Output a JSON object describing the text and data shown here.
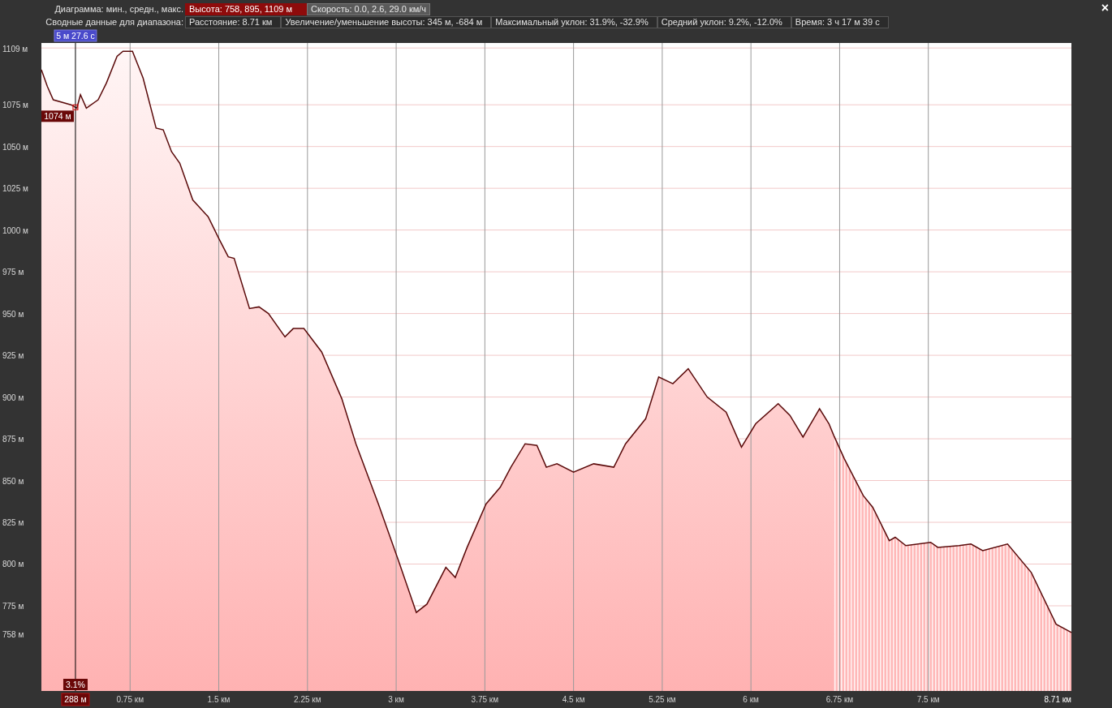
{
  "header": {
    "chart_label": "Диаграмма: мин., средн., макс.",
    "metrics": [
      {
        "text": "Высота: 758, 895, 1109 м",
        "selected": true
      },
      {
        "text": "Скорость: 0.0, 2.6, 29.0 км/ч",
        "selected": false
      }
    ]
  },
  "summary": {
    "label": "Сводные данные для диапазона:",
    "stats": [
      "Расстояние: 8.71 км",
      "Увеличение/уменьшение высоты: 345 м, -684 м",
      "Максимальный уклон: 31.9%, -32.9%",
      "Средний уклон: 9.2%, -12.0%",
      "Время: 3 ч 17 м 39 с"
    ]
  },
  "close": "×",
  "chart": {
    "cursor": {
      "time": "5 м 27.6 с",
      "elevation": "1074 м",
      "slope": "3.1%",
      "distance": "288 м"
    },
    "chart_data": {
      "type": "area",
      "xlim": [
        0,
        8.71
      ],
      "ylim": [
        724,
        1112
      ],
      "x": [
        0,
        0.05,
        0.1,
        0.25,
        0.3,
        0.33,
        0.38,
        0.48,
        0.55,
        0.64,
        0.69,
        0.77,
        0.86,
        0.97,
        1.03,
        1.1,
        1.17,
        1.28,
        1.41,
        1.5,
        1.58,
        1.63,
        1.76,
        1.84,
        1.92,
        2.06,
        2.13,
        2.22,
        2.37,
        2.54,
        2.66,
        2.85,
        3.02,
        3.17,
        3.26,
        3.42,
        3.5,
        3.6,
        3.76,
        3.88,
        3.97,
        4.09,
        4.19,
        4.27,
        4.36,
        4.5,
        4.67,
        4.84,
        4.94,
        5.11,
        5.22,
        5.34,
        5.47,
        5.63,
        5.79,
        5.92,
        6.04,
        6.23,
        6.33,
        6.44,
        6.58,
        6.66,
        6.7,
        6.79,
        6.95,
        7.03,
        7.17,
        7.22,
        7.31,
        7.52,
        7.58,
        7.76,
        7.86,
        7.96,
        8.17,
        8.37,
        8.58,
        8.71
      ],
      "series": [
        {
          "color": "#5a0a0a",
          "values": [
            1096,
            1086,
            1078,
            1075,
            1073,
            1081,
            1073,
            1078,
            1088,
            1104,
            1107,
            1107,
            1091,
            1061,
            1060,
            1047,
            1040,
            1018,
            1008,
            995,
            984,
            983,
            953,
            954,
            950,
            936,
            941,
            941,
            927,
            899,
            872,
            836,
            802,
            771,
            776,
            798,
            792,
            810,
            836,
            846,
            858,
            872,
            871,
            858,
            860,
            855,
            860,
            858,
            872,
            887,
            912,
            908,
            917,
            900,
            891,
            870,
            884,
            896,
            889,
            876,
            893,
            884,
            877,
            null,
            null,
            null,
            null,
            null,
            null,
            null,
            null,
            null,
            null,
            null,
            null,
            null,
            null,
            null
          ]
        },
        {
          "color": "#5a0a0a",
          "values": [
            null,
            null,
            null,
            null,
            null,
            null,
            null,
            null,
            null,
            null,
            null,
            null,
            null,
            null,
            null,
            null,
            null,
            null,
            null,
            null,
            null,
            null,
            null,
            null,
            null,
            null,
            null,
            null,
            null,
            null,
            null,
            null,
            null,
            null,
            null,
            null,
            null,
            null,
            null,
            null,
            null,
            null,
            null,
            null,
            null,
            null,
            null,
            null,
            null,
            null,
            null,
            null,
            null,
            null,
            null,
            null,
            null,
            null,
            null,
            null,
            null,
            null,
            877,
            863,
            841,
            834,
            814,
            816,
            811,
            813,
            810,
            811,
            812,
            808,
            812,
            795,
            764,
            759
          ]
        }
      ],
      "xticks": [
        {
          "value": 0.75,
          "label": "0.75 км"
        },
        {
          "value": 1.5,
          "label": "1.5 км"
        },
        {
          "value": 2.25,
          "label": "2.25 км"
        },
        {
          "value": 3,
          "label": "3 км"
        },
        {
          "value": 3.75,
          "label": "3.75 км"
        },
        {
          "value": 4.5,
          "label": "4.5 км"
        },
        {
          "value": 5.25,
          "label": "5.25 км"
        },
        {
          "value": 6,
          "label": "6 км"
        },
        {
          "value": 6.75,
          "label": "6.75 км"
        },
        {
          "value": 7.5,
          "label": "7.5 км"
        },
        {
          "value": 8.71,
          "label": "8.71 км"
        }
      ],
      "yticks": [
        {
          "value": 1109,
          "label": "1109 м"
        },
        {
          "value": 1075,
          "label": "1075 м"
        },
        {
          "value": 1050,
          "label": "1050 м"
        },
        {
          "value": 1025,
          "label": "1025 м"
        },
        {
          "value": 1000,
          "label": "1000 м"
        },
        {
          "value": 975,
          "label": "975 м"
        },
        {
          "value": 950,
          "label": "950 м"
        },
        {
          "value": 925,
          "label": "925 м"
        },
        {
          "value": 900,
          "label": "900 м"
        },
        {
          "value": 875,
          "label": "875 м"
        },
        {
          "value": 850,
          "label": "850 м"
        },
        {
          "value": 825,
          "label": "825 м"
        },
        {
          "value": 800,
          "label": "800 м"
        },
        {
          "value": 775,
          "label": "775 м"
        },
        {
          "value": 758,
          "label": "758 м"
        }
      ],
      "grid": true,
      "ref_lines": [
        {
          "axis": "x",
          "value": 0.288,
          "color": "#000000"
        }
      ]
    }
  }
}
